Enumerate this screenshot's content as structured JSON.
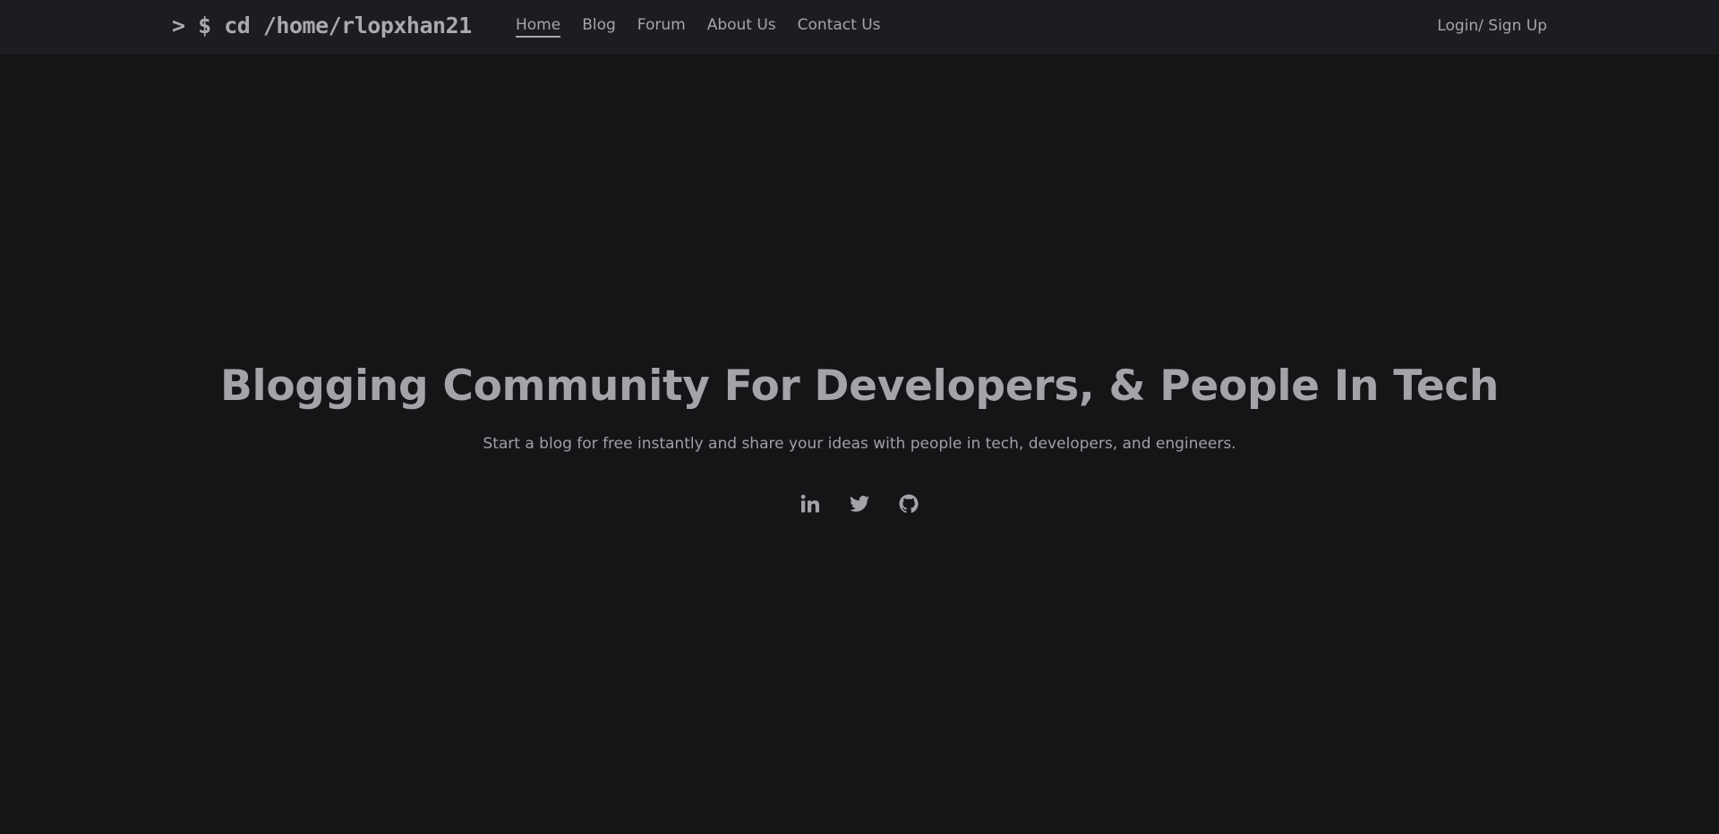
{
  "header": {
    "logo_text": "> $ cd /home/rlopxhan21",
    "nav": [
      {
        "label": "Home",
        "active": true
      },
      {
        "label": "Blog",
        "active": false
      },
      {
        "label": "Forum",
        "active": false
      },
      {
        "label": "About Us",
        "active": false
      },
      {
        "label": "Contact Us",
        "active": false
      }
    ],
    "auth_label": "Login/ Sign Up"
  },
  "hero": {
    "title": "Blogging Community For Developers, & People In Tech",
    "subtitle": "Start a blog for free instantly and share your ideas with people in tech, developers, and engineers.",
    "socials": [
      {
        "icon": "linkedin-icon"
      },
      {
        "icon": "twitter-icon"
      },
      {
        "icon": "github-icon"
      }
    ]
  },
  "colors": {
    "background": "#141517",
    "navbar": "#1c1d20",
    "text": "#a5a5aa"
  }
}
